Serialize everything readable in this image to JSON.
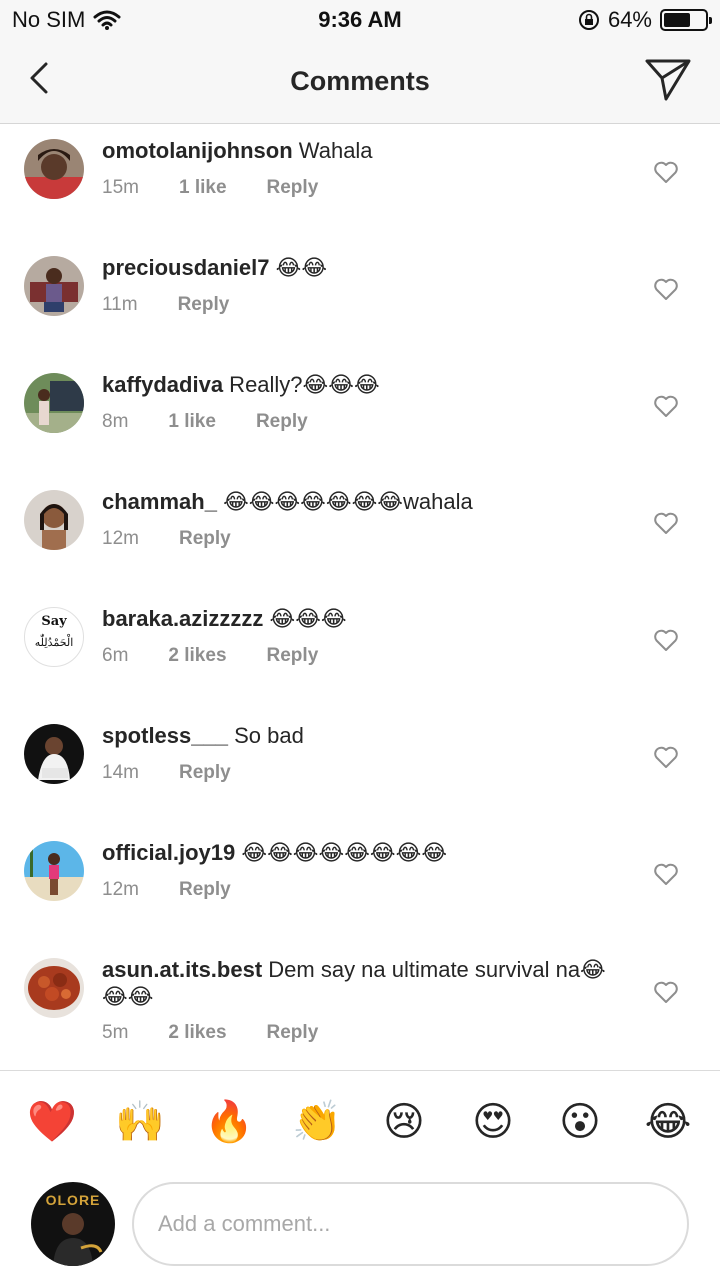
{
  "status_bar": {
    "carrier": "No SIM",
    "time": "9:36 AM",
    "battery": "64%",
    "battery_level": 0.64
  },
  "nav": {
    "title": "Comments"
  },
  "comments": [
    {
      "user": "omotolanijohnson",
      "text": " Wahala",
      "time": "15m",
      "likes": "1 like",
      "reply": "Reply"
    },
    {
      "user": "preciousdaniel7",
      "text": " 😂😂",
      "time": "11m",
      "likes": "",
      "reply": "Reply"
    },
    {
      "user": "kaffydadiva",
      "text": " Really?😂😂😂",
      "time": "8m",
      "likes": "1 like",
      "reply": "Reply"
    },
    {
      "user": "chammah_",
      "text": " 😂😂😂😂😂😂😂wahala",
      "time": "12m",
      "likes": "",
      "reply": "Reply"
    },
    {
      "user": "baraka.azizzzzz",
      "text": " 😂😂😂",
      "time": "6m",
      "likes": "2 likes",
      "reply": "Reply"
    },
    {
      "user": "spotless___",
      "text": " So bad",
      "time": "14m",
      "likes": "",
      "reply": "Reply"
    },
    {
      "user": "official.joy19",
      "text": " 😂😂😂😂😂😂😂😂",
      "time": "12m",
      "likes": "",
      "reply": "Reply"
    },
    {
      "user": "asun.at.its.best",
      "text": " Dem say na ultimate survival na😂😂😂",
      "time": "5m",
      "likes": "2 likes",
      "reply": "Reply"
    }
  ],
  "baraka_avatar": {
    "line1": "Say",
    "line2": "الْحَمْدُلِلّٰه"
  },
  "emoji_bar": [
    "❤️",
    "🙌",
    "🔥",
    "👏",
    "😢",
    "😍",
    "😮",
    "😂"
  ],
  "composer": {
    "placeholder": "Add a comment...",
    "avatar_text": "OLORE"
  },
  "icons": {
    "back": "chevron-left-icon",
    "send": "paper-plane-icon",
    "heart": "heart-outline-icon"
  }
}
